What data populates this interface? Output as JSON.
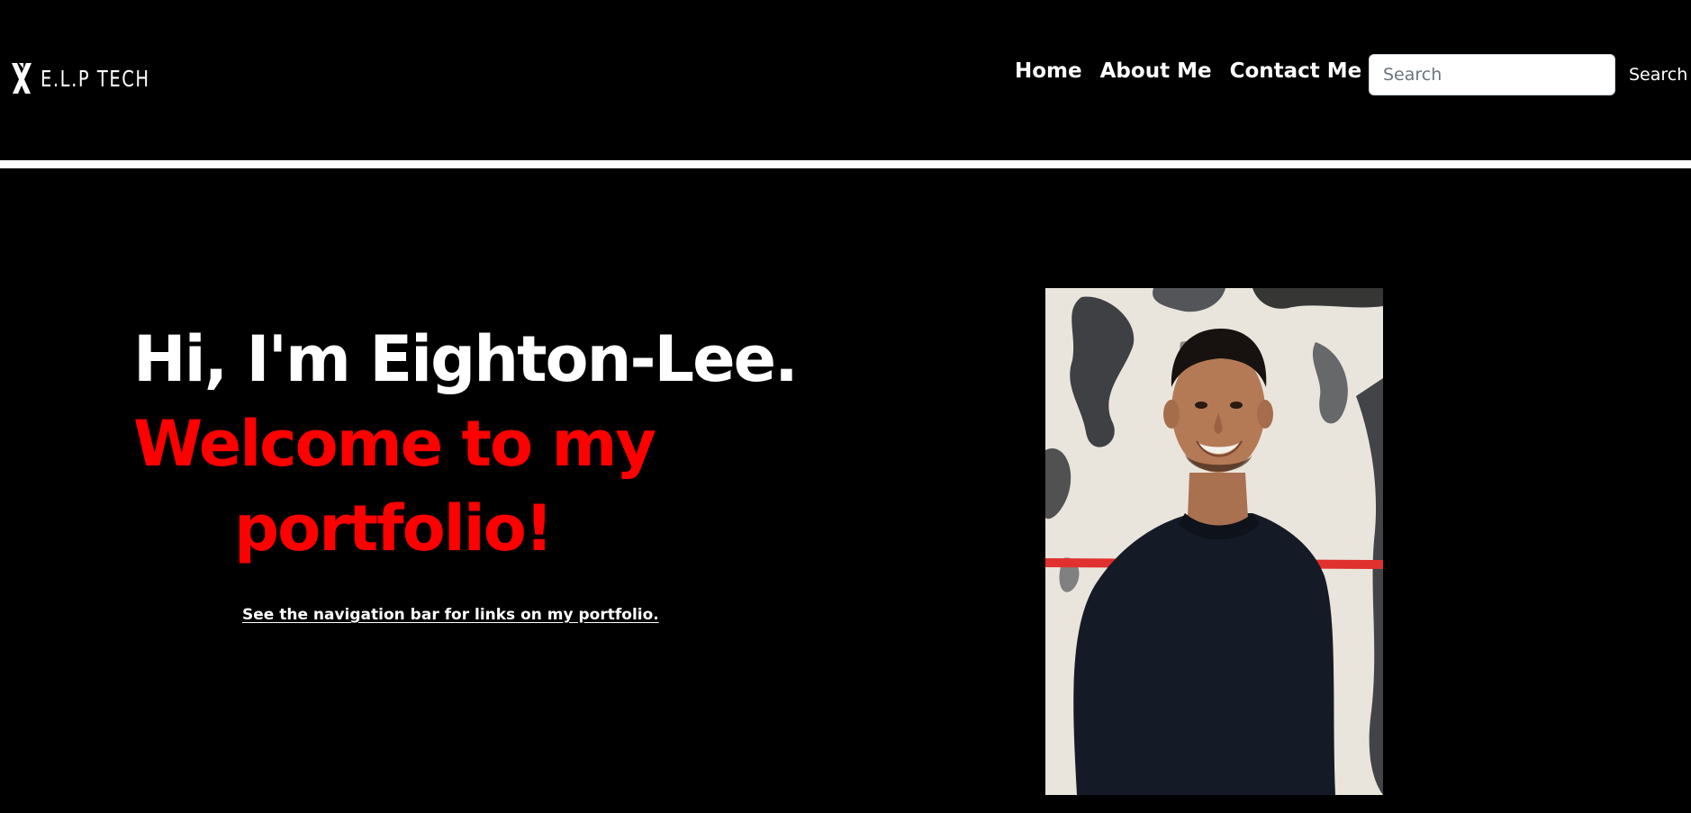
{
  "navbar": {
    "brand_text": "E.L.P TECH",
    "brand_icon": "elp-logo-mark",
    "links": [
      {
        "label": "Home"
      },
      {
        "label": "About Me"
      },
      {
        "label": "Contact Me"
      }
    ],
    "search": {
      "placeholder": "Search",
      "value": "",
      "button_label": "Search"
    }
  },
  "hero": {
    "greeting": "Hi, I'm Eighton-Lee.",
    "welcome_line1": "Welcome to my",
    "welcome_line2": "portfolio!",
    "subtext": "See the navigation bar for links on my portfolio.",
    "photo_icon": "portrait-photo"
  },
  "colors": {
    "background": "#000000",
    "text": "#ffffff",
    "accent": "#ff0000",
    "divider": "#ffffff"
  }
}
